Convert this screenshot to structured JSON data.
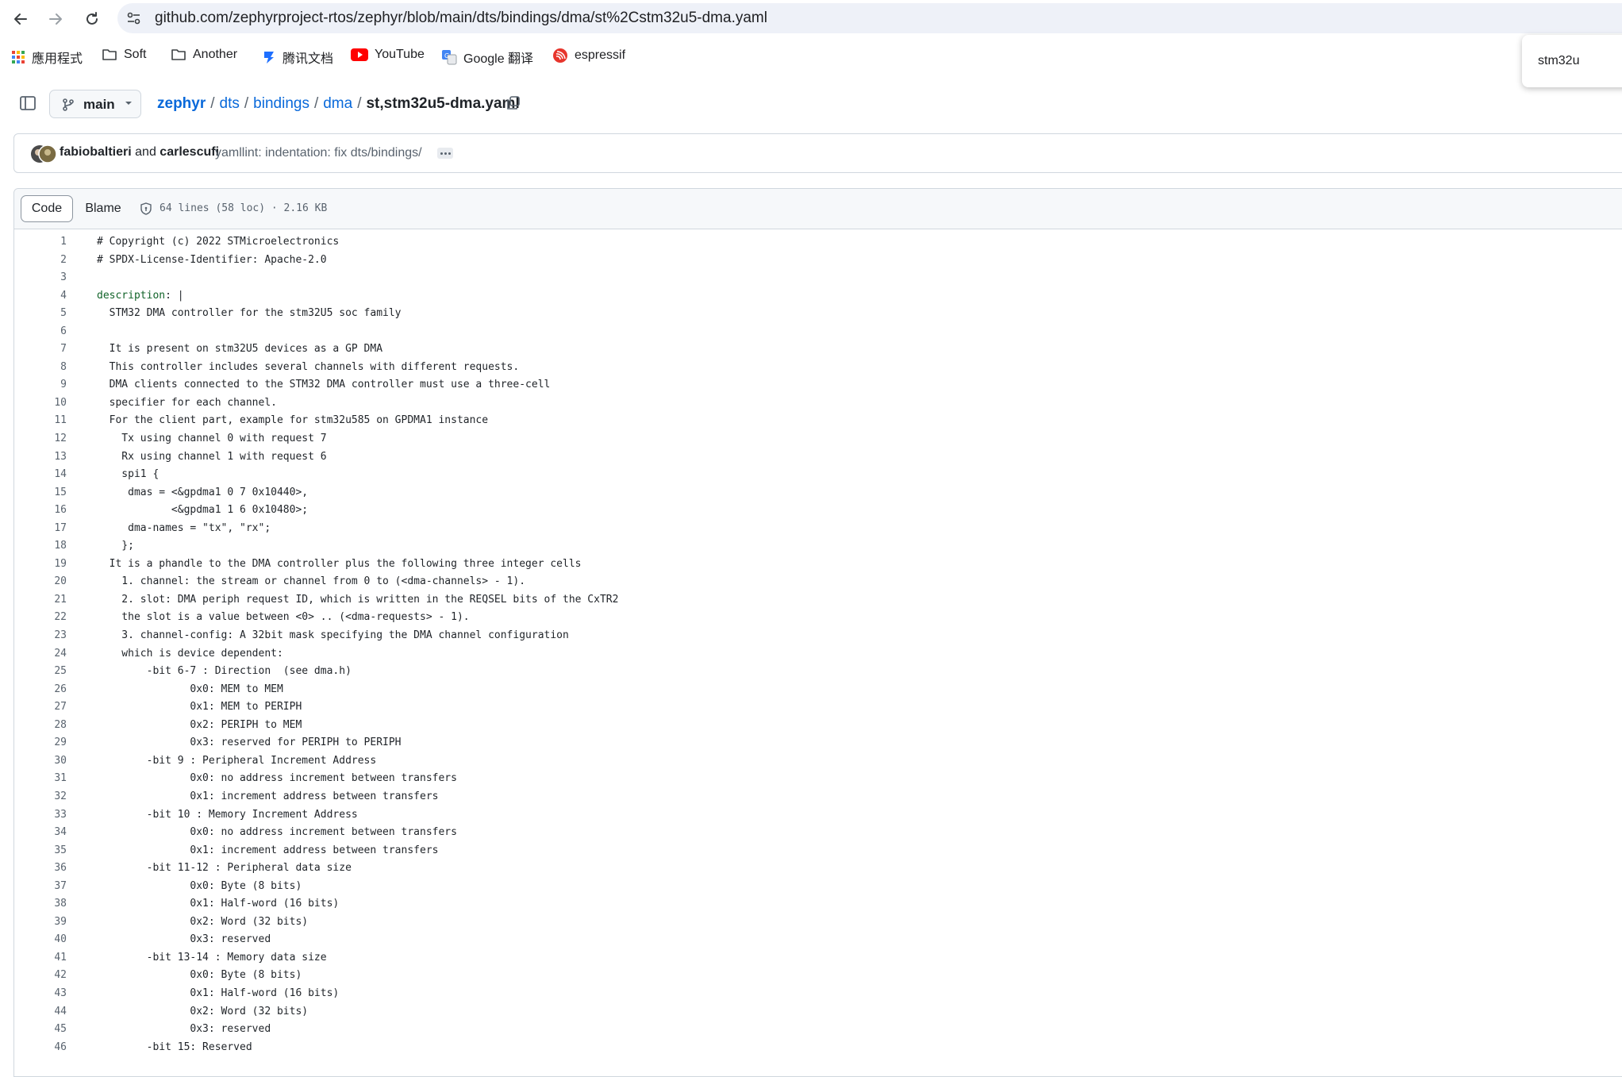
{
  "browser": {
    "url": "github.com/zephyrproject-rtos/zephyr/blob/main/dts/bindings/dma/st%2Cstm32u5-dma.yaml",
    "bookmarks": [
      {
        "label": "應用程式",
        "icon": "apps-grid-icon"
      },
      {
        "label": "Soft",
        "icon": "folder-icon"
      },
      {
        "label": "Another",
        "icon": "folder-icon"
      },
      {
        "label": "腾讯文档",
        "icon": "tencent-docs-icon"
      },
      {
        "label": "YouTube",
        "icon": "youtube-icon"
      },
      {
        "label": "Google 翻译",
        "icon": "google-translate-icon"
      },
      {
        "label": "espressif",
        "icon": "espressif-icon"
      }
    ],
    "find_text": "stm32u"
  },
  "repo": {
    "branch": "main",
    "breadcrumb": [
      "zephyr",
      "dts",
      "bindings",
      "dma"
    ],
    "filename": "st,stm32u5-dma.yaml"
  },
  "commit": {
    "author1": "fabiobaltieri",
    "and_text": "and",
    "author2": "carlescufi",
    "message": "yamllint: indentation: fix dts/bindings/"
  },
  "file": {
    "tab_code": "Code",
    "tab_blame": "Blame",
    "meta": "64 lines (58 loc) · 2.16 KB"
  },
  "code_lines": [
    "# Copyright (c) 2022 STMicroelectronics",
    "# SPDX-License-Identifier: Apache-2.0",
    "",
    "description: |",
    "  STM32 DMA controller for the stm32U5 soc family",
    "",
    "  It is present on stm32U5 devices as a GP DMA",
    "  This controller includes several channels with different requests.",
    "  DMA clients connected to the STM32 DMA controller must use a three-cell",
    "  specifier for each channel.",
    "  For the client part, example for stm32u585 on GPDMA1 instance",
    "    Tx using channel 0 with request 7",
    "    Rx using channel 1 with request 6",
    "    spi1 {",
    "     dmas = <&gpdma1 0 7 0x10440>,",
    "            <&gpdma1 1 6 0x10480>;",
    "     dma-names = \"tx\", \"rx\";",
    "    };",
    "  It is a phandle to the DMA controller plus the following three integer cells",
    "    1. channel: the stream or channel from 0 to (<dma-channels> - 1).",
    "    2. slot: DMA periph request ID, which is written in the REQSEL bits of the CxTR2",
    "    the slot is a value between <0> .. (<dma-requests> - 1).",
    "    3. channel-config: A 32bit mask specifying the DMA channel configuration",
    "    which is device dependent:",
    "        -bit 6-7 : Direction  (see dma.h)",
    "               0x0: MEM to MEM",
    "               0x1: MEM to PERIPH",
    "               0x2: PERIPH to MEM",
    "               0x3: reserved for PERIPH to PERIPH",
    "        -bit 9 : Peripheral Increment Address",
    "               0x0: no address increment between transfers",
    "               0x1: increment address between transfers",
    "        -bit 10 : Memory Increment Address",
    "               0x0: no address increment between transfers",
    "               0x1: increment address between transfers",
    "        -bit 11-12 : Peripheral data size",
    "               0x0: Byte (8 bits)",
    "               0x1: Half-word (16 bits)",
    "               0x2: Word (32 bits)",
    "               0x3: reserved",
    "        -bit 13-14 : Memory data size",
    "               0x0: Byte (8 bits)",
    "               0x1: Half-word (16 bits)",
    "               0x2: Word (32 bits)",
    "               0x3: reserved",
    "        -bit 15: Reserved"
  ],
  "colors": {
    "link": "#0969da",
    "yaml_key": "#116329",
    "muted": "#59636e"
  }
}
